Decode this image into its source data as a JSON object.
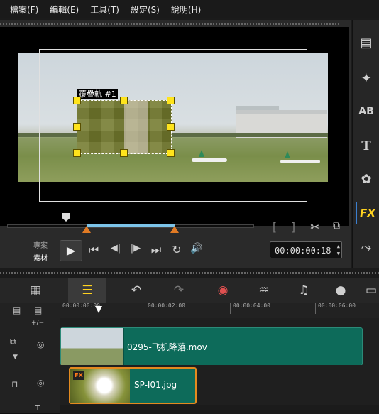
{
  "menu": [
    "檔案(F)",
    "編輯(E)",
    "工具(T)",
    "設定(S)",
    "說明(H)"
  ],
  "preview": {
    "overlay_label": "覆疊軌 #1",
    "mode_project": "專案",
    "mode_clip": "素材",
    "timecode": "00:00:00:18",
    "trim_in": "[",
    "trim_out": "]",
    "scrub_position": 0.24
  },
  "controls": {
    "play": "▶",
    "to_start": "⏮",
    "prev_frame": "◀|",
    "next_frame": "|▶",
    "to_end": "⏭",
    "repeat": "↻",
    "volume": "🔊",
    "cut": "✂",
    "spin_up": "▲",
    "spin_down": "▼"
  },
  "side_tabs": [
    {
      "icon": "media-library-icon",
      "glyph": "▤"
    },
    {
      "icon": "instant-project-icon",
      "glyph": "✦"
    },
    {
      "icon": "title-ab-icon",
      "glyph": "AB"
    },
    {
      "icon": "text-t-icon",
      "glyph": "T"
    },
    {
      "icon": "graphic-icon",
      "glyph": "✿"
    },
    {
      "icon": "fx-filter-icon",
      "glyph": "FX"
    },
    {
      "icon": "path-motion-icon",
      "glyph": "⤳"
    }
  ],
  "toolbar": [
    {
      "icon": "storyboard-view-icon",
      "glyph": "▦"
    },
    {
      "icon": "timeline-view-icon",
      "glyph": "☰"
    },
    {
      "icon": "undo-icon",
      "glyph": "↶"
    },
    {
      "icon": "redo-icon",
      "glyph": "↷"
    },
    {
      "icon": "record-capture-icon",
      "glyph": "◉"
    },
    {
      "icon": "sound-mixer-icon",
      "glyph": "♒"
    },
    {
      "icon": "auto-music-icon",
      "glyph": "♫"
    },
    {
      "icon": "motion-tracking-icon",
      "glyph": "●"
    },
    {
      "icon": "subtitle-icon",
      "glyph": "▭"
    }
  ],
  "ruler": [
    "00:00:00:00",
    "00:00:02:00",
    "00:00:04:00",
    "00:00:06:00"
  ],
  "tracks": {
    "video_clip": "0295-飞机降落.mov",
    "overlay_clip": "SP-I01.jpg",
    "fx_badge": "FX",
    "add_remove": "+/−"
  }
}
